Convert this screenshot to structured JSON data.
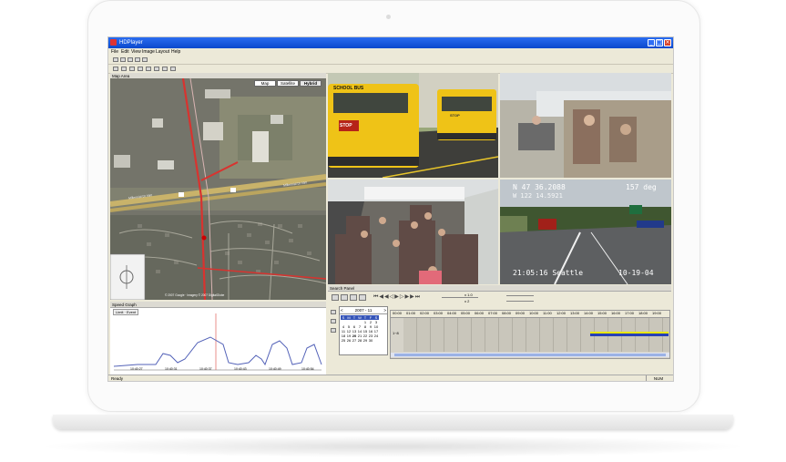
{
  "window": {
    "title": "HDPlayer"
  },
  "menu": [
    "File",
    "Edit",
    "View",
    "Image",
    "Layout",
    "Help"
  ],
  "map_panel": {
    "title": "Map Area",
    "buttons": [
      "Map",
      "Satellite",
      "Hybrid"
    ],
    "road_labels": [
      "Millennial Dr NW",
      "Millennial Dr NW"
    ],
    "copyright": "© 2007 Google · Imagery © 2007 DigitalGlobe"
  },
  "graph_panel": {
    "title": "Speed Graph",
    "buttons": "Limit · Event",
    "x_labels": [
      "10:40:27",
      "10:40:31",
      "10:40:37",
      "10:40:43",
      "10:40:49",
      "10:40:54"
    ]
  },
  "cameras": [
    {
      "name": "front-exterior",
      "overlay_left": "",
      "overlay_right": ""
    },
    {
      "name": "interior-rear",
      "overlay_left": "",
      "overlay_right": ""
    },
    {
      "name": "interior-front",
      "overlay_left": "",
      "overlay_right": ""
    },
    {
      "name": "road-view",
      "overlay_top_left": "N 47 36.2088",
      "overlay_top_right": "157 deg",
      "overlay_top2": "W 122 14.5921",
      "overlay_bottom_left": "21:05:16 Seattle",
      "overlay_bottom_right": "10-19-04"
    }
  ],
  "bus_text": {
    "school_bus": "SCHOOL BUS",
    "stop": "STOP",
    "stop2": "STOP"
  },
  "search_panel": {
    "title": "Search Panel",
    "speed_top": "x 1.0",
    "speed_bottom": "x 2",
    "calendar": {
      "month_label": "2007 - 11",
      "weekdays": [
        "S",
        "M",
        "T",
        "W",
        "T",
        "F",
        "S"
      ],
      "weeks": [
        [
          "",
          "",
          "",
          "",
          "1",
          "2",
          "3"
        ],
        [
          "4",
          "5",
          "6",
          "7",
          "8",
          "9",
          "10"
        ],
        [
          "11",
          "12",
          "13",
          "14",
          "15",
          "16",
          "17"
        ],
        [
          "18",
          "19",
          "20",
          "21",
          "22",
          "23",
          "24"
        ],
        [
          "25",
          "26",
          "27",
          "28",
          "29",
          "30",
          ""
        ]
      ]
    },
    "hours": [
      "00:00",
      "01:00",
      "02:00",
      "03:00",
      "04:00",
      "05:00",
      "06:00",
      "07:00",
      "08:00",
      "09:00",
      "10:00",
      "11:00",
      "12:00",
      "13:00",
      "14:00",
      "15:00",
      "16:00",
      "17:00",
      "18:00",
      "19:00"
    ],
    "channel_label": "1~8"
  },
  "status": {
    "text": "Ready",
    "mode": "NUM"
  },
  "colors": {
    "titlebar": "#0b48cc",
    "timeline_recorded": "#2740b6",
    "timeline_event": "#e8e600"
  }
}
